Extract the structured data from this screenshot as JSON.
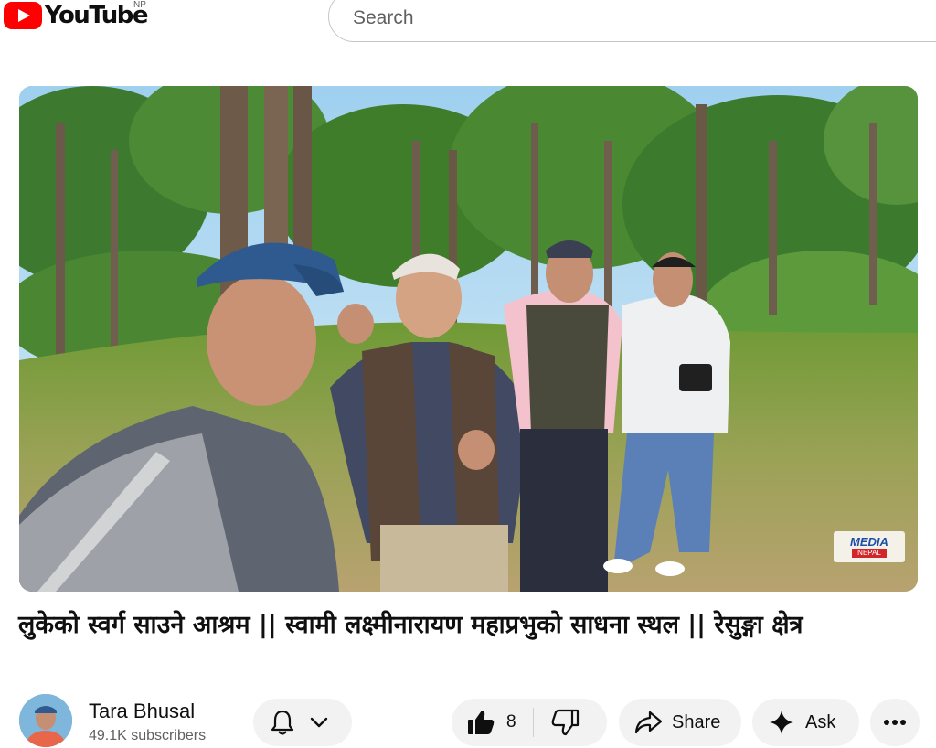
{
  "header": {
    "logo_text": "YouTube",
    "country_code": "NP",
    "search_placeholder": "Search"
  },
  "video": {
    "title": "लुकेको स्वर्ग साउने आश्रम || स्वामी लक्ष्मीनारायण महाप्रभुको साधना स्थल || रेसुङ्गा क्षेत्र",
    "watermark_line1": "MEDIA",
    "watermark_line2": "NEPAL"
  },
  "channel": {
    "name": "Tara Bhusal",
    "subscribers": "49.1K subscribers"
  },
  "actions": {
    "like_count": "8",
    "share_label": "Share",
    "ask_label": "Ask"
  },
  "icons": [
    "youtube-logo-icon",
    "bell-icon",
    "chevron-down-icon",
    "thumbs-up-icon",
    "thumbs-down-icon",
    "share-icon",
    "sparkle-icon",
    "more-icon"
  ],
  "colors": {
    "brand_red": "#ff0000",
    "pill_bg": "#f2f2f2",
    "text_primary": "#0f0f0f",
    "text_secondary": "#606060"
  }
}
